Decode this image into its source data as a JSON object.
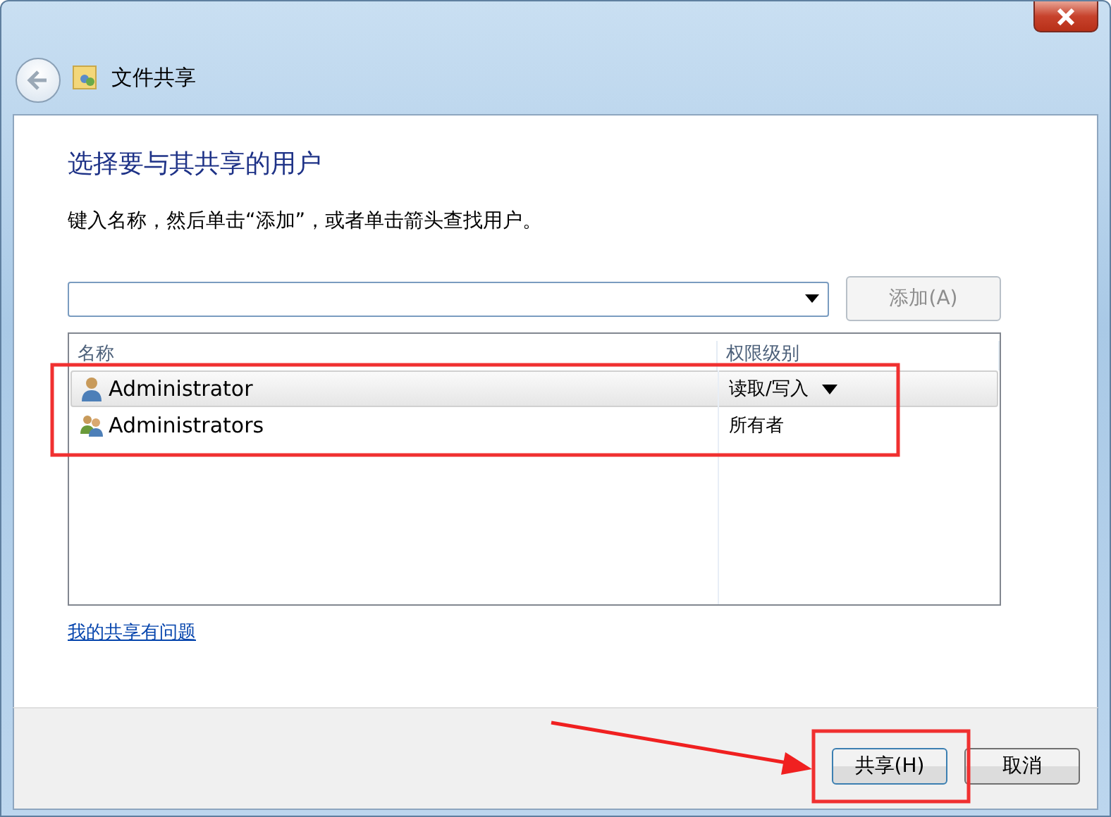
{
  "window": {
    "title": "文件共享"
  },
  "heading": "选择要与其共享的用户",
  "instruction": "键入名称，然后单击“添加”，或者单击箭头查找用户。",
  "add_button": {
    "label": "添加(A)",
    "disabled": true
  },
  "table": {
    "columns": [
      "名称",
      "权限级别"
    ],
    "rows": [
      {
        "name": "Administrator",
        "kind": "user",
        "permission": "读取/写入",
        "has_menu": true,
        "selected": true
      },
      {
        "name": "Administrators",
        "kind": "group",
        "permission": "所有者",
        "has_menu": false,
        "selected": false
      }
    ]
  },
  "help_link": "我的共享有问题",
  "buttons": [
    {
      "label": "共享(H)",
      "kind": "primary"
    },
    {
      "label": "取消",
      "kind": "normal"
    }
  ]
}
